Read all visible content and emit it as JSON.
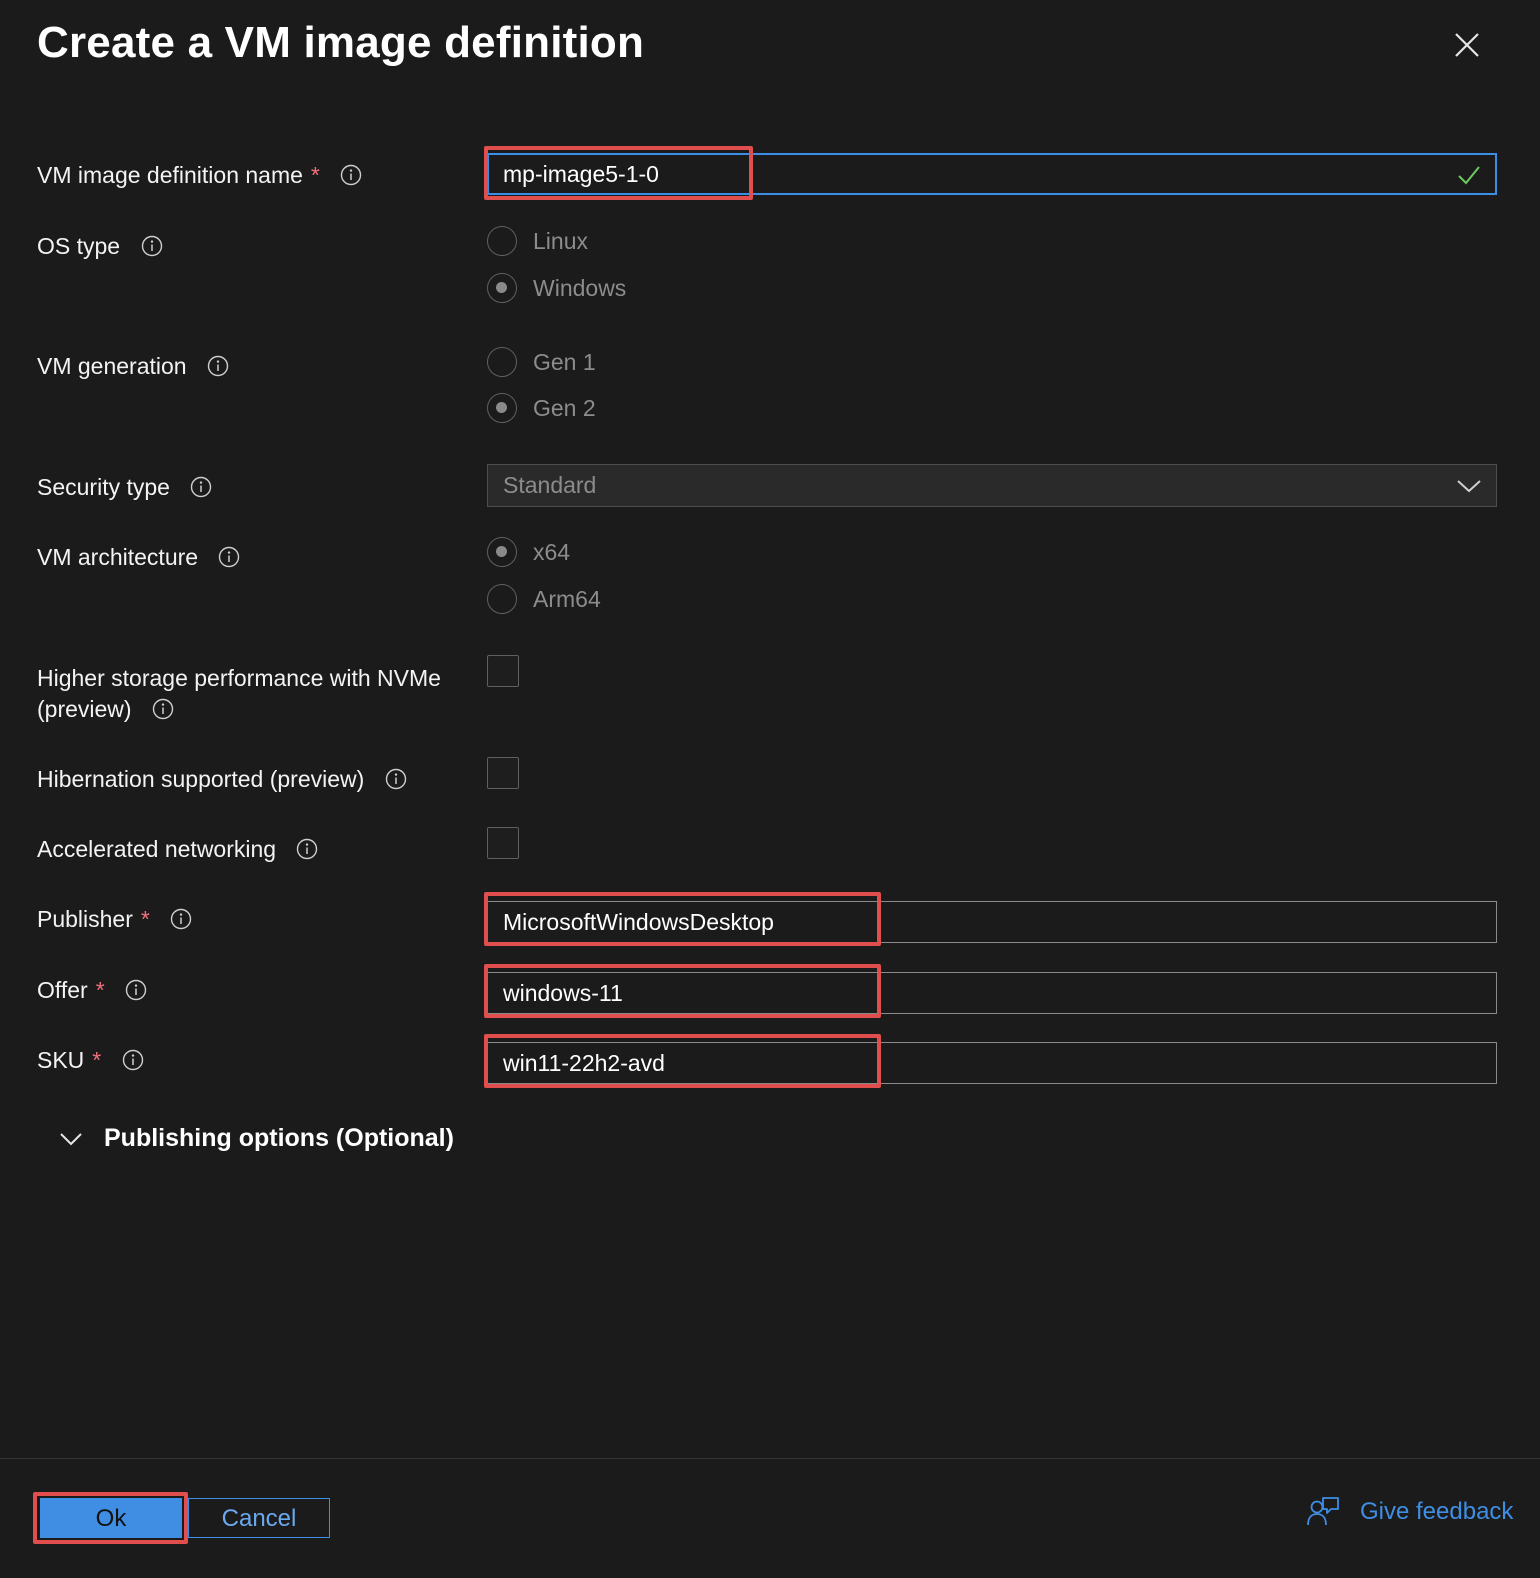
{
  "dialog": {
    "title": "Create a VM image definition",
    "close_label": "close"
  },
  "fields": {
    "image_name": {
      "label": "VM image definition name",
      "required": "*",
      "value": "mp-image5-1-0"
    },
    "os_type": {
      "label": "OS type",
      "options": [
        "Linux",
        "Windows"
      ],
      "selected": "Windows"
    },
    "vm_generation": {
      "label": "VM generation",
      "options": [
        "Gen 1",
        "Gen 2"
      ],
      "selected": "Gen 2"
    },
    "security_type": {
      "label": "Security type",
      "value": "Standard"
    },
    "vm_architecture": {
      "label": "VM architecture",
      "options": [
        "x64",
        "Arm64"
      ],
      "selected": "x64"
    },
    "nvme": {
      "label_line1": "Higher storage performance with NVMe",
      "label_line2": "(preview)",
      "checked": false
    },
    "hibernation": {
      "label": "Hibernation supported (preview)",
      "checked": false
    },
    "accelerated_networking": {
      "label": "Accelerated networking",
      "checked": false
    },
    "publisher": {
      "label": "Publisher",
      "required": "*",
      "value": "MicrosoftWindowsDesktop"
    },
    "offer": {
      "label": "Offer",
      "required": "*",
      "value": "windows-11"
    },
    "sku": {
      "label": "SKU",
      "required": "*",
      "value": "win11-22h2-avd"
    }
  },
  "publishing_options": {
    "label": "Publishing options (Optional)"
  },
  "footer": {
    "ok_label": "Ok",
    "cancel_label": "Cancel",
    "feedback_label": "Give feedback"
  },
  "colors": {
    "background": "#1b1b1b",
    "accent": "#3f8ee4",
    "required": "#f1707b",
    "highlight": "#e04e4e",
    "valid": "#6ccb5f"
  }
}
